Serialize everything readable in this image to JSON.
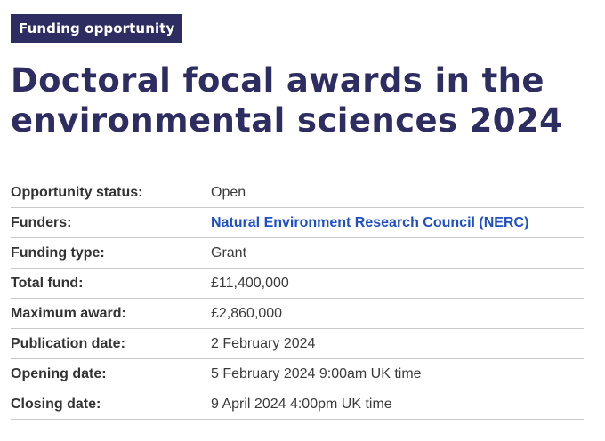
{
  "tag": "Funding opportunity",
  "title": "Doctoral focal awards in the environmental sciences 2024",
  "details": [
    {
      "label": "Opportunity status:",
      "value": "Open"
    },
    {
      "label": "Funders:",
      "value": "Natural Environment Research Council (NERC)",
      "link": true
    },
    {
      "label": "Funding type:",
      "value": "Grant"
    },
    {
      "label": "Total fund:",
      "value": "£11,400,000"
    },
    {
      "label": "Maximum award:",
      "value": "£2,860,000"
    },
    {
      "label": "Publication date:",
      "value": "2 February 2024"
    },
    {
      "label": "Opening date:",
      "value": "5 February 2024 9:00am UK time"
    },
    {
      "label": "Closing date:",
      "value": "9 April 2024 4:00pm UK time"
    }
  ],
  "colors": {
    "brand": "#2e2d62",
    "link": "#1f4fc4",
    "divider": "#c9c9c9"
  }
}
